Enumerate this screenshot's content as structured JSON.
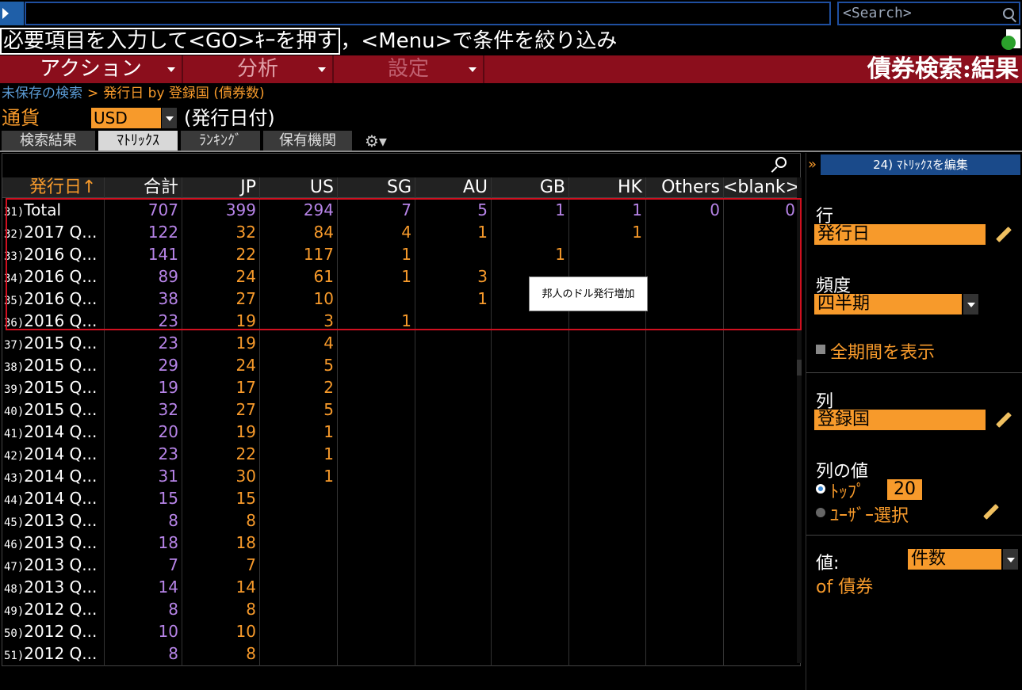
{
  "search": {
    "placeholder": "<Search>"
  },
  "hint": {
    "boxed": "必要項目を入力して<GO>ｷｰを押す",
    "rest": "，<Menu>で条件を絞り込み"
  },
  "menu": {
    "action": "アクション",
    "analysis": "分析",
    "settings": "設定"
  },
  "page_title": "債券検索:結果",
  "breadcrumb": {
    "link": "未保存の検索",
    "sep": ">",
    "path": "発行日",
    "by": "by",
    "tail": "登録国 (債券数)"
  },
  "currency": {
    "label": "通貨",
    "value": "USD",
    "note": "(発行日付)"
  },
  "tabs": [
    "検索結果",
    "ﾏﾄﾘｯｸｽ",
    "ﾗﾝｷﾝｸﾞ",
    "保有機関"
  ],
  "table": {
    "headers": [
      "発行日↑",
      "合計",
      "JP",
      "US",
      "SG",
      "AU",
      "GB",
      "HK",
      "Others",
      "<blank>"
    ],
    "rows": [
      {
        "num": "31)",
        "label": "Total",
        "vals": [
          "707",
          "399",
          "294",
          "7",
          "5",
          "1",
          "1",
          "0",
          "0"
        ]
      },
      {
        "num": "32)",
        "label": "2017 Q...",
        "vals": [
          "122",
          "32",
          "84",
          "4",
          "1",
          "",
          "1",
          "",
          ""
        ]
      },
      {
        "num": "33)",
        "label": "2016 Q...",
        "vals": [
          "141",
          "22",
          "117",
          "1",
          "",
          "1",
          "",
          "",
          ""
        ]
      },
      {
        "num": "34)",
        "label": "2016 Q...",
        "vals": [
          "89",
          "24",
          "61",
          "1",
          "3",
          "",
          "",
          "",
          ""
        ]
      },
      {
        "num": "35)",
        "label": "2016 Q...",
        "vals": [
          "38",
          "27",
          "10",
          "",
          "1",
          "",
          "",
          "",
          ""
        ]
      },
      {
        "num": "36)",
        "label": "2016 Q...",
        "vals": [
          "23",
          "19",
          "3",
          "1",
          "",
          "",
          "",
          "",
          ""
        ]
      },
      {
        "num": "37)",
        "label": "2015 Q...",
        "vals": [
          "23",
          "19",
          "4",
          "",
          "",
          "",
          "",
          "",
          ""
        ]
      },
      {
        "num": "38)",
        "label": "2015 Q...",
        "vals": [
          "29",
          "24",
          "5",
          "",
          "",
          "",
          "",
          "",
          ""
        ]
      },
      {
        "num": "39)",
        "label": "2015 Q...",
        "vals": [
          "19",
          "17",
          "2",
          "",
          "",
          "",
          "",
          "",
          ""
        ]
      },
      {
        "num": "40)",
        "label": "2015 Q...",
        "vals": [
          "32",
          "27",
          "5",
          "",
          "",
          "",
          "",
          "",
          ""
        ]
      },
      {
        "num": "41)",
        "label": "2014 Q...",
        "vals": [
          "20",
          "19",
          "1",
          "",
          "",
          "",
          "",
          "",
          ""
        ]
      },
      {
        "num": "42)",
        "label": "2014 Q...",
        "vals": [
          "23",
          "22",
          "1",
          "",
          "",
          "",
          "",
          "",
          ""
        ]
      },
      {
        "num": "43)",
        "label": "2014 Q...",
        "vals": [
          "31",
          "30",
          "1",
          "",
          "",
          "",
          "",
          "",
          ""
        ]
      },
      {
        "num": "44)",
        "label": "2014 Q...",
        "vals": [
          "15",
          "15",
          "",
          "",
          "",
          "",
          "",
          "",
          ""
        ]
      },
      {
        "num": "45)",
        "label": "2013 Q...",
        "vals": [
          "8",
          "8",
          "",
          "",
          "",
          "",
          "",
          "",
          ""
        ]
      },
      {
        "num": "46)",
        "label": "2013 Q...",
        "vals": [
          "18",
          "18",
          "",
          "",
          "",
          "",
          "",
          "",
          ""
        ]
      },
      {
        "num": "47)",
        "label": "2013 Q...",
        "vals": [
          "7",
          "7",
          "",
          "",
          "",
          "",
          "",
          "",
          ""
        ]
      },
      {
        "num": "48)",
        "label": "2013 Q...",
        "vals": [
          "14",
          "14",
          "",
          "",
          "",
          "",
          "",
          "",
          ""
        ]
      },
      {
        "num": "49)",
        "label": "2012 Q...",
        "vals": [
          "8",
          "8",
          "",
          "",
          "",
          "",
          "",
          "",
          ""
        ]
      },
      {
        "num": "50)",
        "label": "2012 Q...",
        "vals": [
          "10",
          "10",
          "",
          "",
          "",
          "",
          "",
          "",
          ""
        ]
      },
      {
        "num": "51)",
        "label": "2012 Q...",
        "vals": [
          "8",
          "8",
          "",
          "",
          "",
          "",
          "",
          "",
          ""
        ]
      }
    ]
  },
  "tooltip": "邦人のドル発行増加",
  "side": {
    "collapse": "»",
    "head": "24) ﾏﾄﾘｯｸｽを編集",
    "row_label": "行",
    "row_value": "発行日",
    "freq_label": "頻度",
    "freq_value": "四半期",
    "show_all": "全期間を表示",
    "col_label": "列",
    "col_value": "登録国",
    "col_values_label": "列の値",
    "top_label": "ﾄｯﾌﾟ",
    "top_value": "20",
    "user_select": "ﾕｰｻﾞｰ選択",
    "value_label": "値:",
    "value_value": "件数",
    "of_text": "of 債券"
  },
  "colors": {
    "accent": "#f79a2b",
    "total": "#b784e8",
    "menubar": "#8b0e1c",
    "highlight": "#d01020"
  }
}
